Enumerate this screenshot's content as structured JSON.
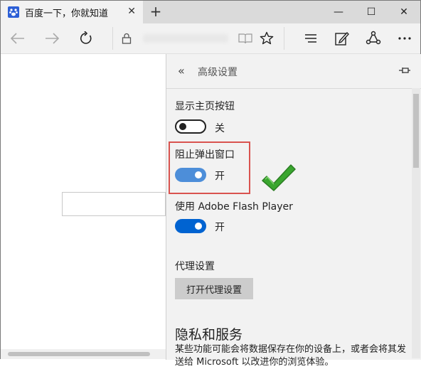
{
  "browser": {
    "tab_title": "百度一下，你就知道",
    "tab_close": "✕",
    "new_tab": "+",
    "window_controls": {
      "minimize": "—",
      "maximize": "☐",
      "close": "✕"
    }
  },
  "settings_pane": {
    "title": "高级设置",
    "back_glyph": "«",
    "settings": [
      {
        "label": "显示主页按钮",
        "state": "关",
        "enabled": false
      },
      {
        "label": "阻止弹出窗口",
        "state": "开",
        "enabled": true,
        "highlighted": true
      },
      {
        "label": "使用 Adobe Flash Player",
        "state": "开",
        "enabled": true
      }
    ],
    "proxy": {
      "label": "代理设置",
      "button": "打开代理设置"
    },
    "privacy": {
      "heading": "隐私和服务",
      "description": "某些功能可能会将数据保存在你的设备上，或者会将其发送给 Microsoft 以改进你的浏览体验。"
    }
  },
  "colors": {
    "toggle_on": "#0063d1",
    "highlight_box": "#d9534f",
    "checkmark": "#3aa62f",
    "pane_background": "#f2f2f2"
  }
}
